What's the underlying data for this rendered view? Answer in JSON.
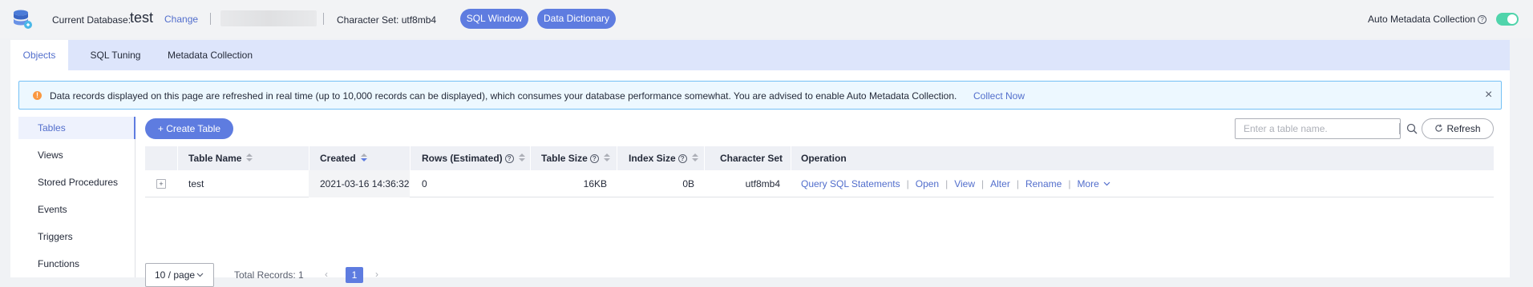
{
  "header": {
    "db_label": "Current Database:",
    "db_name": "test",
    "change_label": "Change",
    "charset_label": "Character Set: utf8mb4",
    "sql_window_label": "SQL Window",
    "data_dictionary_label": "Data Dictionary",
    "auto_metadata_label": "Auto Metadata Collection",
    "auto_metadata_enabled": true
  },
  "tabs": [
    {
      "label": "Objects",
      "active": true
    },
    {
      "label": "SQL Tuning",
      "active": false
    },
    {
      "label": "Metadata Collection",
      "active": false
    }
  ],
  "notice": {
    "text": "Data records displayed on this page are refreshed in real time (up to 10,000 records can be displayed), which consumes your database performance somewhat. You are advised to enable Auto Metadata Collection.",
    "link_label": "Collect Now",
    "close_glyph": "×"
  },
  "sidebar": {
    "items": [
      {
        "label": "Tables",
        "active": true
      },
      {
        "label": "Views",
        "active": false
      },
      {
        "label": "Stored Procedures",
        "active": false
      },
      {
        "label": "Events",
        "active": false
      },
      {
        "label": "Triggers",
        "active": false
      },
      {
        "label": "Functions",
        "active": false
      }
    ]
  },
  "toolbar": {
    "create_table_label": "+ Create Table",
    "search_placeholder": "Enter a table name.",
    "refresh_label": "Refresh"
  },
  "table": {
    "columns": [
      "Table Name",
      "Created",
      "Rows (Estimated)",
      "Table Size",
      "Index Size",
      "Character Set",
      "Operation"
    ],
    "rows": [
      {
        "name": "test",
        "created": "2021-03-16 14:36:32",
        "rows": "0",
        "table_size": "16KB",
        "index_size": "0B",
        "charset": "utf8mb4",
        "operations": [
          "Query SQL Statements",
          "Open",
          "View",
          "Alter",
          "Rename",
          "More"
        ]
      }
    ]
  },
  "pagination": {
    "page_size": "10 / page",
    "total_label": "Total Records: 1",
    "current_page": "1",
    "prev_glyph": "‹",
    "next_glyph": "›"
  },
  "colors": {
    "accent": "#5e7ce0",
    "link": "#526ecc",
    "toggle_on": "#50d4ab",
    "notice_bg": "#edf8ff",
    "warning": "#fa9841"
  }
}
